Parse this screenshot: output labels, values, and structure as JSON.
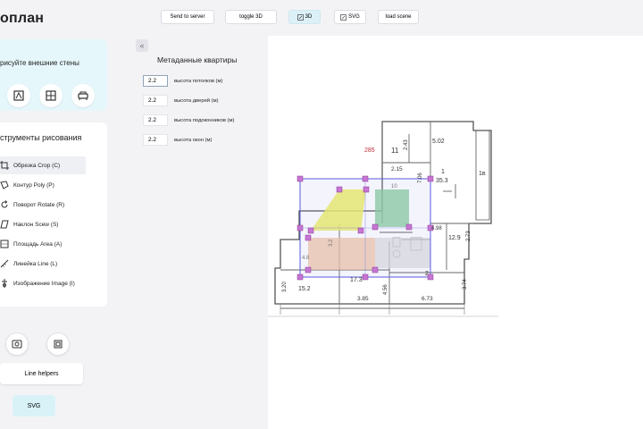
{
  "app": {
    "title": "оплан"
  },
  "walls": {
    "hint": "рисуйте внешние стены"
  },
  "tools": {
    "title": "струменты рисования",
    "items": [
      {
        "id": "crop",
        "label": "Обрезка Crop (C)",
        "icon": "crop-icon"
      },
      {
        "id": "poly",
        "label": "Контур Poly (P)",
        "icon": "poly-icon"
      },
      {
        "id": "rotate",
        "label": "Поворот Rotate (R)",
        "icon": "rotate-icon"
      },
      {
        "id": "scew",
        "label": "Наклон Scew (S)",
        "icon": "scew-icon"
      },
      {
        "id": "area",
        "label": "Площадь Area (A)",
        "icon": "area-icon"
      },
      {
        "id": "line",
        "label": "Линейка Line (L)",
        "icon": "ruler-icon"
      },
      {
        "id": "image",
        "label": "Изображение Image (I)",
        "icon": "image-icon"
      }
    ]
  },
  "buttons": {
    "line_helpers": "Line helpers",
    "svg": "SVG"
  },
  "toolbar": {
    "send": "Send to server",
    "toggle3d": "toggle 3D",
    "view3d": "3D",
    "svg": "SVG",
    "load": "load scene"
  },
  "meta": {
    "title": "Метаданные квартиры",
    "fields": [
      {
        "value": "2.2",
        "label": "высота потолков (м)"
      },
      {
        "value": "2.2",
        "label": "высота дверей (м)"
      },
      {
        "value": "2.2",
        "label": "высота подоконников (м)"
      },
      {
        "value": "2.2",
        "label": "высота окон (м)"
      }
    ]
  },
  "plan": {
    "labels": [
      "285",
      "11",
      "2.43",
      "5.02",
      "2.15",
      "1",
      "35.3",
      "1в",
      "7.06",
      "4.98",
      "12.9",
      "2.73",
      "3.20",
      "15.2",
      "17.3",
      "4.56",
      "3.85",
      "6.73",
      "3.74",
      "2",
      "4.8",
      "3.2",
      "10"
    ]
  },
  "colors": {
    "accent": "#d9f2f8",
    "selection": "#5a5ae0",
    "handle": "#b34fc4",
    "yellow": "#eef06a",
    "green": "#8fd0a0",
    "orange": "#f2c7a6"
  }
}
